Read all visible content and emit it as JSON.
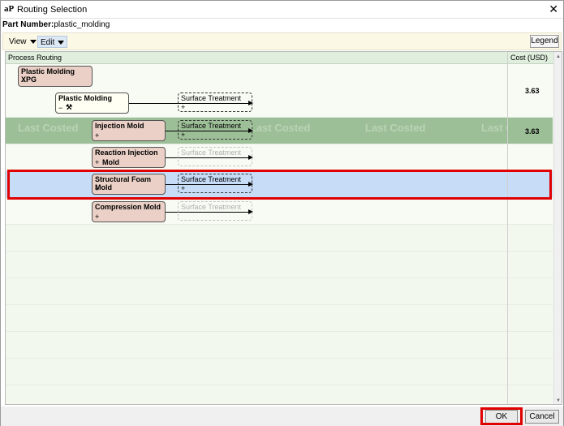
{
  "window": {
    "title": "Routing Selection",
    "app_logo": "aP",
    "close_label": "✕"
  },
  "part": {
    "label": "Part Number:",
    "value": "plastic_molding"
  },
  "toolbar": {
    "view_label": "View",
    "edit_label": "Edit",
    "legend_label": "Legend"
  },
  "grid": {
    "col_process": "Process Routing",
    "col_cost": "Cost (USD)",
    "watermark": "Last Costed",
    "watermark_partial": "Last C"
  },
  "nodes": {
    "root": {
      "label": "Plastic Molding XPG",
      "toggle": "−"
    },
    "plastic_molding": {
      "label": "Plastic Molding",
      "toggle": "−",
      "tool_icon": "hammer-icon"
    },
    "st1": {
      "label": "Surface Treatment",
      "toggle": "+"
    },
    "injection": {
      "label": "Injection Mold",
      "toggle": "+"
    },
    "st2": {
      "label": "Surface Treatment",
      "toggle": "+"
    },
    "reaction": {
      "label": "Reaction Injection",
      "label2": "Mold",
      "toggle": "+"
    },
    "st3": {
      "label": "Surface Treatment"
    },
    "foam": {
      "label": "Structural Foam Mold",
      "toggle": "+"
    },
    "st4": {
      "label": "Surface Treatment",
      "toggle": "+"
    },
    "compression": {
      "label": "Compression Mold",
      "toggle": "+"
    },
    "st5": {
      "label": "Surface Treatment"
    }
  },
  "costs": {
    "plastic_molding": "3.63",
    "injection": "3.63"
  },
  "buttons": {
    "ok": "OK",
    "cancel": "Cancel"
  },
  "colors": {
    "highlight_row": "#9dbf97",
    "selected_row": "#c7dcf7",
    "annotation": "#e00000"
  }
}
